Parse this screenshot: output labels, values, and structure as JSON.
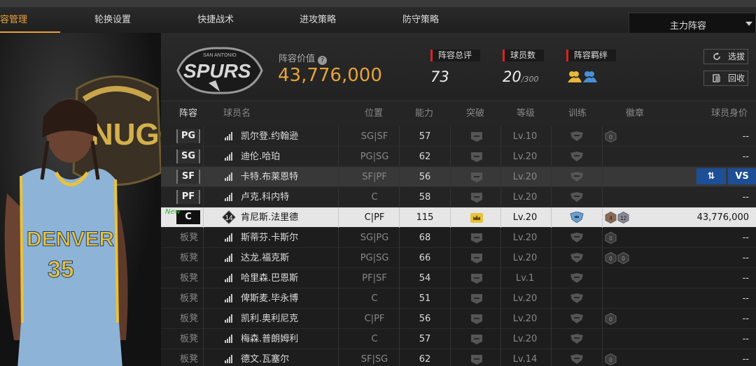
{
  "tabs": [
    {
      "label": "容管理",
      "active": true
    },
    {
      "label": "轮换设置"
    },
    {
      "label": "快捷战术"
    },
    {
      "label": "进攻策略"
    },
    {
      "label": "防守策略"
    }
  ],
  "lineup_select": {
    "value": "主力阵容"
  },
  "header": {
    "team_logo_text": "SPURS",
    "team_logo_small": "SAN ANTONIO",
    "value_label": "阵容价值",
    "value": "43,776,000",
    "rating_label": "阵容总评",
    "rating": "73",
    "count_label": "球员数",
    "count": "20",
    "count_max": "/300",
    "bond_label": "阵容羁绊",
    "select_button": "选拔",
    "recycle_button": "回收"
  },
  "player_image": {
    "jersey_team": "DENVER",
    "jersey_number": "35",
    "logo_text": "NUGGETS"
  },
  "columns": [
    "阵容",
    "球员名",
    "位置",
    "能力",
    "突破",
    "等级",
    "训练",
    "徽章",
    "球员身价"
  ],
  "rows": [
    {
      "slot": "PG",
      "name": "凯尔登.约翰逊",
      "position": "SG|SF",
      "ability": "57",
      "level": "Lv.10",
      "badges": [
        "0"
      ],
      "price": "--"
    },
    {
      "slot": "SG",
      "name": "迪伦.哈珀",
      "position": "PG|SG",
      "ability": "62",
      "level": "Lv.20",
      "badges": [],
      "price": "--"
    },
    {
      "slot": "SF",
      "name": "卡特.布莱恩特",
      "position": "SF|PF",
      "ability": "56",
      "level": "Lv.20",
      "badges": [],
      "price": "",
      "swap_label": "⇅",
      "vs_label": "VS"
    },
    {
      "slot": "PF",
      "name": "卢克.科内特",
      "position": "C",
      "ability": "58",
      "level": "Lv.20",
      "badges": [],
      "price": "--"
    },
    {
      "slot": "C",
      "name": "肯尼斯.法里德",
      "position": "C|PF",
      "ability": "115",
      "level": "Lv.20",
      "badges": [
        "4",
        "12"
      ],
      "price": "43,776,000",
      "new_label": "New",
      "rank": "14"
    },
    {
      "slot": "板凳",
      "name": "斯蒂芬.卡斯尔",
      "position": "SG|PG",
      "ability": "68",
      "level": "Lv.20",
      "badges": [
        "0"
      ],
      "price": "--"
    },
    {
      "slot": "板凳",
      "name": "达龙.福克斯",
      "position": "PG|SG",
      "ability": "66",
      "level": "Lv.20",
      "badges": [
        "0",
        "0"
      ],
      "price": "--"
    },
    {
      "slot": "板凳",
      "name": "哈里森.巴恩斯",
      "position": "PF|SF",
      "ability": "54",
      "level": "Lv.1",
      "badges": [],
      "price": "--"
    },
    {
      "slot": "板凳",
      "name": "俾斯麦.毕永博",
      "position": "C",
      "ability": "51",
      "level": "Lv.20",
      "badges": [],
      "price": "--"
    },
    {
      "slot": "板凳",
      "name": "凯利.奥利尼克",
      "position": "C|PF",
      "ability": "56",
      "level": "Lv.20",
      "badges": [
        "0"
      ],
      "price": "--"
    },
    {
      "slot": "板凳",
      "name": "梅森.普朗姆利",
      "position": "C",
      "ability": "57",
      "level": "Lv.20",
      "badges": [],
      "price": "--"
    },
    {
      "slot": "板凳",
      "name": "德文.瓦塞尔",
      "position": "SF|SG",
      "ability": "62",
      "level": "Lv.14",
      "badges": [
        "0"
      ],
      "price": "--"
    }
  ],
  "colors": {
    "accent": "#e8a33a",
    "stat_marker": "#dd2222",
    "action_blue": "#1d4e96",
    "new_green": "#2ab52a"
  }
}
